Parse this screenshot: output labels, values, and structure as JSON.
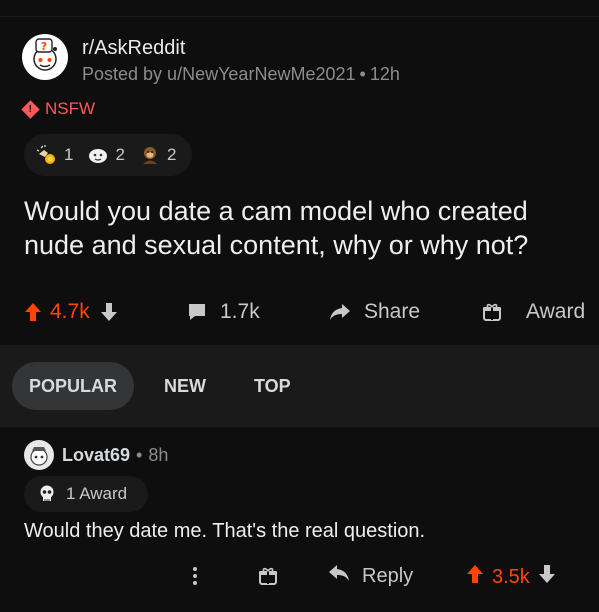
{
  "post": {
    "subreddit": "r/AskReddit",
    "posted_by": "Posted by u/NewYearNewMe2021",
    "age": "12h",
    "nsfw_label": "NSFW",
    "awards": [
      {
        "icon": "helpful-hand-award-icon",
        "count": "1"
      },
      {
        "icon": "wholesome-award-icon",
        "count": "2"
      },
      {
        "icon": "monkey-award-icon",
        "count": "2"
      }
    ],
    "title": "Would you date a cam model who created nude and sexual content, why or why not?",
    "votes": "4.7k",
    "comments": "1.7k",
    "share_label": "Share",
    "award_label": "Award"
  },
  "sort": {
    "tabs": [
      "POPULAR",
      "NEW",
      "TOP"
    ],
    "active": "POPULAR"
  },
  "comment": {
    "user": "Lovat69",
    "age": "8h",
    "award_text": "1 Award",
    "body": "Would they date me. That's the real question.",
    "reply_label": "Reply",
    "votes": "3.5k"
  },
  "colors": {
    "upvote": "#ff4500",
    "nsfw": "#ff585b",
    "background": "#0e0e0e",
    "panel": "#1a1a1b"
  }
}
